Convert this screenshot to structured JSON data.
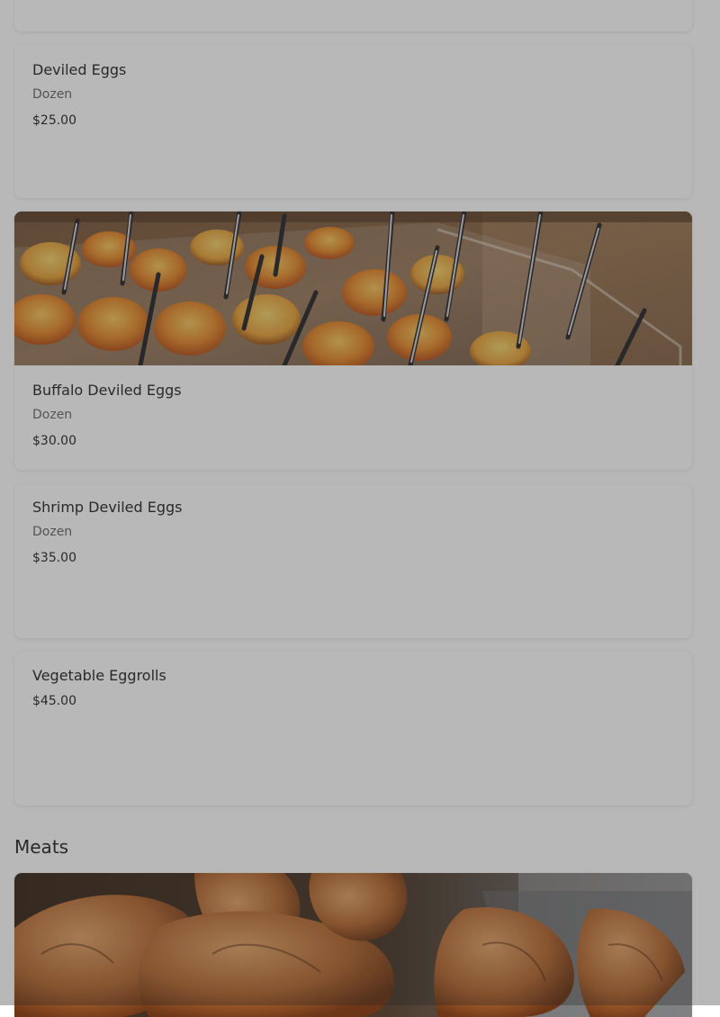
{
  "menu": {
    "items": [
      {
        "name": "Deviled Eggs",
        "description": "Dozen",
        "price": "$25.00"
      },
      {
        "name": "Buffalo Deviled Eggs",
        "description": "Dozen",
        "price": "$30.00",
        "photo": "buffalo-deviled-eggs-tray-photo"
      },
      {
        "name": "Shrimp Deviled Eggs",
        "description": "Dozen",
        "price": "$35.00"
      },
      {
        "name": "Vegetable Eggrolls",
        "price": "$45.00"
      }
    ],
    "sections": [
      {
        "title": "Meats",
        "photo": "fried-chicken-photo"
      }
    ]
  },
  "colors": {
    "overlay": "#282828",
    "card": "#ffffff",
    "text": "#2b2b2b",
    "muted": "#6b6b6b"
  }
}
